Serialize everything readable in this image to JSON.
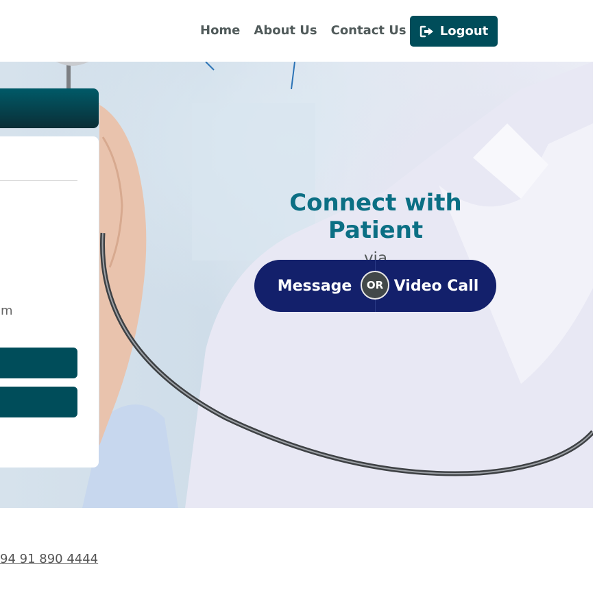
{
  "nav": {
    "links": [
      "Home",
      "About Us",
      "Contact Us"
    ],
    "logout_label": "Logout",
    "logout_icon": "sign-out-icon"
  },
  "hero": {
    "side_card": {
      "partial_text": "om"
    },
    "title": "Connect with Patient",
    "subtitle": "via",
    "options": {
      "message_label": "Message",
      "or_label": "OR",
      "video_label": "Video Call"
    }
  },
  "footer": {
    "phone": "94 91 890 4444"
  },
  "colors": {
    "primary": "#004d5a",
    "title": "#0b6f84",
    "toggle": "#13206b",
    "or_badge": "#424849"
  }
}
